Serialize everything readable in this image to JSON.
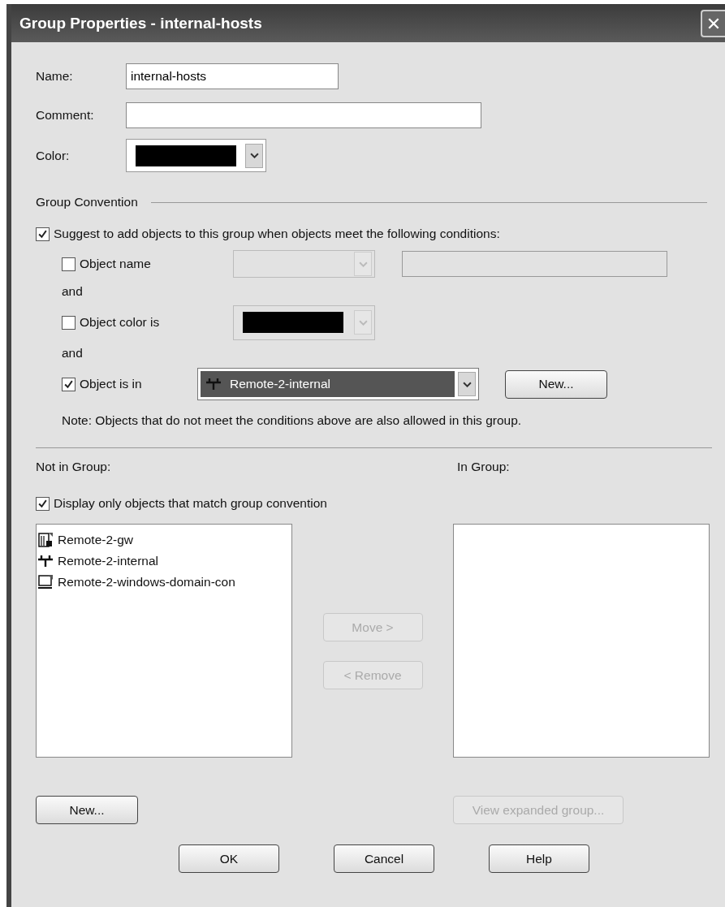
{
  "window": {
    "title": "Group Properties - internal-hosts"
  },
  "fields": [
    {
      "kind": "text",
      "label": "Name:",
      "value": "internal-hosts"
    },
    {
      "kind": "text",
      "label": "Comment:"
    },
    {
      "kind": "color",
      "label": "Color:",
      "color": "#000000"
    }
  ],
  "group_convention": {
    "heading": "Group Convention",
    "suggest": {
      "label": "Suggest to add objects to this group when objects meet the following conditions:",
      "checked": true
    },
    "conditions": [
      {
        "kind": "name",
        "label": "Object name",
        "checked": false
      },
      {
        "kind": "color",
        "connector": "and",
        "label": "Object color is",
        "checked": false,
        "color": "#000000"
      },
      {
        "kind": "group",
        "connector": "and",
        "label": "Object is in",
        "checked": true,
        "value": "Remote-2-internal",
        "button": "New..."
      }
    ],
    "note": "Note: Objects that do not meet the conditions above are also allowed in this group."
  },
  "not_in_group": {
    "label": "Not in Group:",
    "filter": {
      "label": "Display only objects that match group convention",
      "checked": true
    },
    "items": [
      {
        "kind": "gateway",
        "label": "Remote-2-gw"
      },
      {
        "kind": "network",
        "label": "Remote-2-internal"
      },
      {
        "kind": "host",
        "label": "Remote-2-windows-domain-con"
      }
    ],
    "new_button": "New..."
  },
  "in_group": {
    "label": "In Group:",
    "view_button": {
      "label": "View expanded group...",
      "disabled": true
    }
  },
  "move_buttons": [
    {
      "label": "Move  >",
      "disabled": true
    },
    {
      "label": "<  Remove",
      "disabled": true
    }
  ],
  "buttons": [
    {
      "label": "OK",
      "disabled": false
    },
    {
      "label": "Cancel",
      "disabled": false
    },
    {
      "label": "Help",
      "disabled": false
    }
  ]
}
